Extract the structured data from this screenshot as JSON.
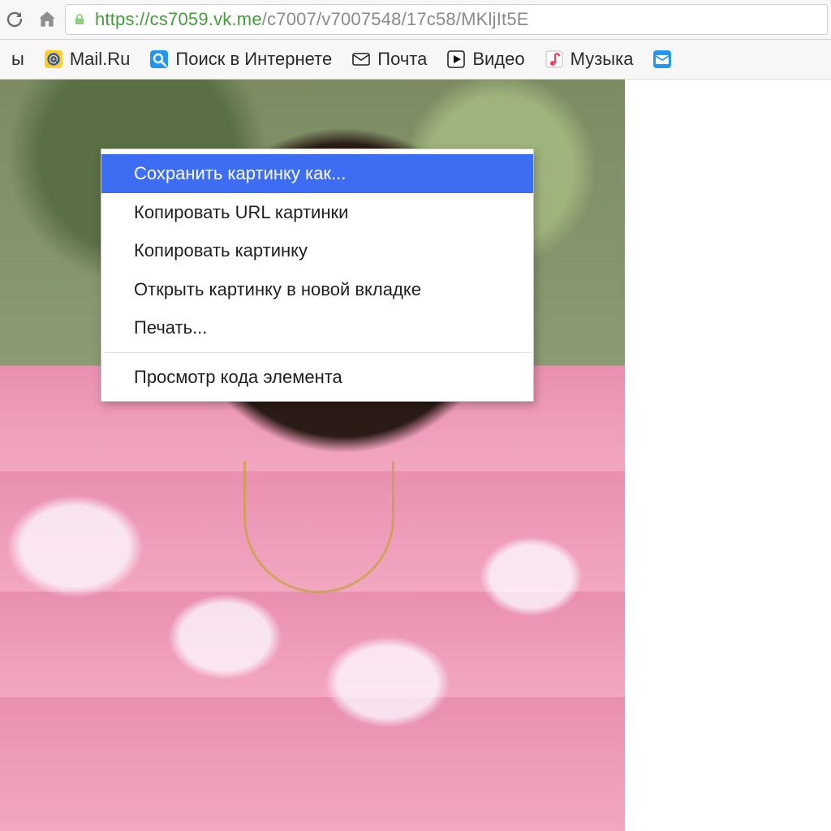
{
  "url": {
    "scheme_text": "https",
    "sep_text": "://",
    "host_text": "cs7059.vk.me",
    "path_text": "/c7007/v7007548/17c58/MKljIt5E"
  },
  "bookmarks": {
    "items": [
      {
        "label": "ы",
        "icon": "none"
      },
      {
        "label": "Mail.Ru",
        "icon": "mailru"
      },
      {
        "label": "Поиск в Интернете",
        "icon": "search"
      },
      {
        "label": "Почта",
        "icon": "envelope"
      },
      {
        "label": "Видео",
        "icon": "play"
      },
      {
        "label": "Музыка",
        "icon": "note"
      },
      {
        "label": "",
        "icon": "envelope"
      }
    ]
  },
  "context_menu": {
    "items": [
      {
        "label": "Сохранить картинку как...",
        "highlight": true
      },
      {
        "label": "Копировать URL картинки",
        "highlight": false
      },
      {
        "label": "Копировать картинку",
        "highlight": false
      },
      {
        "label": "Открыть картинку в новой вкладке",
        "highlight": false
      },
      {
        "label": "Печать...",
        "highlight": false
      },
      {
        "label": "__sep__"
      },
      {
        "label": "Просмотр кода элемента",
        "highlight": false
      }
    ]
  },
  "content_image": {
    "description": "Photograph of a person with dark curly hair wearing a pink floral shirt and a gold necklace"
  }
}
